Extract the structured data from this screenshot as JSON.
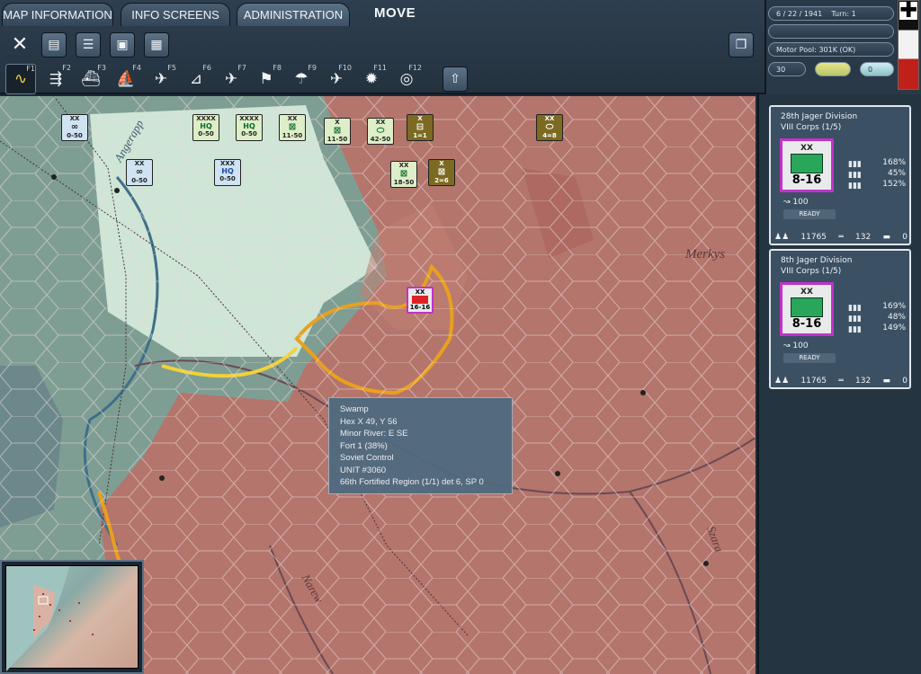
{
  "tabs": {
    "map_info": "MAP INFORMATION",
    "info_screens": "INFO SCREENS",
    "administration": "ADMINISTRATION"
  },
  "mode": "MOVE",
  "toolbar_icons": [
    "close-icon",
    "unit-list-icon",
    "report-list-icon",
    "save-icon",
    "grid-icon",
    "window-icon"
  ],
  "fkeys": [
    {
      "label": "F1",
      "icon": "move-path-icon"
    },
    {
      "label": "F2",
      "icon": "rail-icon"
    },
    {
      "label": "F3",
      "icon": "naval-icon"
    },
    {
      "label": "F4",
      "icon": "transport-ship-icon"
    },
    {
      "label": "F5",
      "icon": "air-recon-icon"
    },
    {
      "label": "F6",
      "icon": "airfield-icon"
    },
    {
      "label": "F7",
      "icon": "air-transfer-icon"
    },
    {
      "label": "F8",
      "icon": "ground-support-icon"
    },
    {
      "label": "F9",
      "icon": "air-drop-icon"
    },
    {
      "label": "F10",
      "icon": "bombing-icon"
    },
    {
      "label": "F11",
      "icon": "explosion-icon"
    },
    {
      "label": "F12",
      "icon": "compass-icon"
    }
  ],
  "upload_icon": "upload-icon",
  "status": {
    "date": "6 / 22 / 1941",
    "turn": "Turn:  1",
    "motor_pool": "Motor Pool:  301K (OK)",
    "field1": "30",
    "field2": "0"
  },
  "map": {
    "labels": [
      "Merkys",
      "Angerapp",
      "Narew",
      "Szara"
    ]
  },
  "units": [
    {
      "id": "u1",
      "sz": "XX",
      "st": "0-50",
      "type": "reserve",
      "color": "#cfe3f2"
    },
    {
      "id": "u2",
      "sz": "XXXX",
      "st": "0-50",
      "type": "HQ",
      "color": "#ddeec8"
    },
    {
      "id": "u3",
      "sz": "XXXX",
      "st": "0-50",
      "type": "HQ",
      "color": "#ddeec8"
    },
    {
      "id": "u4",
      "sz": "XX",
      "st": "11-50",
      "type": "inf",
      "color": "#ddeec8"
    },
    {
      "id": "u5",
      "sz": "X",
      "st": "11-50",
      "type": "inf",
      "color": "#ddeec8"
    },
    {
      "id": "u6",
      "sz": "XX",
      "st": "42-50",
      "type": "armor",
      "color": "#ddeec8"
    },
    {
      "id": "u7",
      "sz": "X",
      "st": "1=1",
      "type": "rail",
      "color": "#7d6a22"
    },
    {
      "id": "u8",
      "sz": "XX",
      "st": "4=8",
      "type": "armor",
      "color": "#7d6a22"
    },
    {
      "id": "u9",
      "sz": "XXX",
      "st": "0-50",
      "type": "HQ",
      "color": "#cfe3f2"
    },
    {
      "id": "u10",
      "sz": "XX",
      "st": "0-50",
      "type": "mot",
      "color": "#cfe3f2"
    },
    {
      "id": "u11",
      "sz": "XX",
      "st": "18-50",
      "type": "inf",
      "color": "#ddeec8"
    },
    {
      "id": "u12",
      "sz": "X",
      "st": "2=6",
      "type": "inf",
      "color": "#7d6a22"
    }
  ],
  "tooltip": {
    "line1": "Swamp",
    "line2": "Hex X 49, Y 56",
    "line3": "Minor River: E SE",
    "line4": "Fort  1  (38%)",
    "line5": "Soviet Control",
    "line6": "UNIT #3060",
    "line7": "66th Fortified Region    (1/1) det 6, SP 0"
  },
  "cards": [
    {
      "name": "28th Jager Division",
      "corps": "VIII Corps (1/5)",
      "size": "XX",
      "strength": "8-16",
      "p1": "168%",
      "p2": "45%",
      "p3": "152%",
      "mov": "100",
      "ready": "READY",
      "men": "11765",
      "guns": "132",
      "tanks": "0"
    },
    {
      "name": "8th Jager Division",
      "corps": "VIII Corps (1/5)",
      "size": "XX",
      "strength": "8-16",
      "p1": "169%",
      "p2": "48%",
      "p3": "149%",
      "mov": "100",
      "ready": "READY",
      "men": "11765",
      "guns": "132",
      "tanks": "0"
    }
  ],
  "colors": {
    "soviet": "#b4756c",
    "axis_light": "#cfe5d6",
    "panel": "#253441"
  }
}
